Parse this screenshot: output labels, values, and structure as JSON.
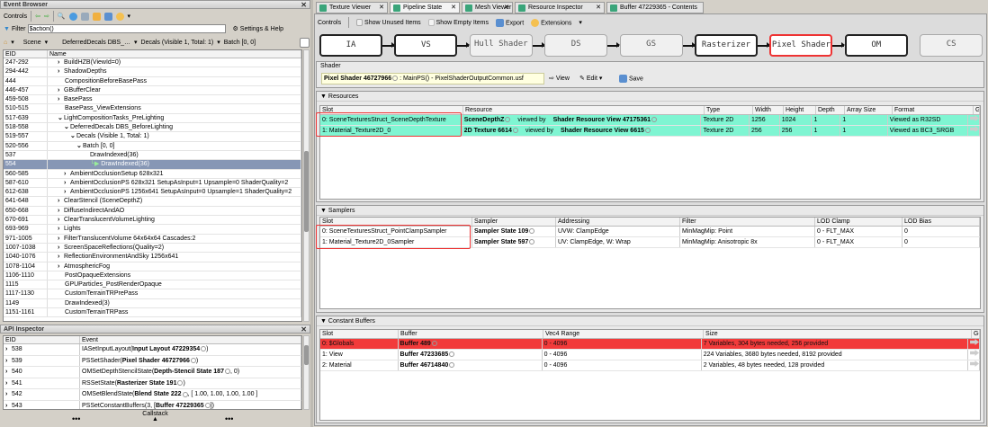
{
  "event_browser": {
    "title": "Event Browser",
    "controls_label": "Controls",
    "filter_label": "Filter",
    "filter_value": "$action()",
    "settings_label": "Settings & Help",
    "breadcrumb": [
      "Scene",
      "DeferredDecals DBS_…",
      "Decals (Visible 1, Total: 1)",
      "Batch [0, 0]"
    ],
    "columns": [
      "EID",
      "Name"
    ],
    "rows": [
      [
        "247-292",
        "BuildHZB(ViewId=0)",
        0,
        "closed"
      ],
      [
        "294-442",
        "ShadowDepths",
        0,
        "closed"
      ],
      [
        "444",
        "CompositionBeforeBasePass",
        0,
        "none"
      ],
      [
        "446-457",
        "GBufferClear",
        0,
        "closed"
      ],
      [
        "459-508",
        "BasePass",
        0,
        "closed"
      ],
      [
        "510-515",
        "BasePass_ViewExtensions",
        0,
        "none"
      ],
      [
        "517-639",
        "LightCompositionTasks_PreLighting",
        0,
        "open"
      ],
      [
        "518-558",
        "DeferredDecals DBS_BeforeLighting",
        1,
        "open"
      ],
      [
        "519-557",
        "Decals (Visible 1, Total: 1)",
        2,
        "open"
      ],
      [
        "520-556",
        "Batch [0, 0]",
        3,
        "open"
      ],
      [
        "537",
        "DrawIndexed(36)",
        4,
        "none"
      ],
      [
        "554",
        "DrawIndexed(36)",
        4,
        "current"
      ],
      [
        "560-585",
        "AmbientOcclusionSetup 628x321",
        1,
        "closed"
      ],
      [
        "587-610",
        "AmbientOcclusionPS 628x321 SetupAsInput=1 Upsample=0 ShaderQuality=2",
        1,
        "closed"
      ],
      [
        "612-638",
        "AmbientOcclusionPS 1256x641 SetupAsInput=0 Upsample=1 ShaderQuality=2",
        1,
        "closed"
      ],
      [
        "641-648",
        "ClearStencil (SceneDepthZ)",
        0,
        "closed"
      ],
      [
        "650-668",
        "DiffuseIndirectAndAO",
        0,
        "closed"
      ],
      [
        "670-691",
        "ClearTranslucentVolumeLighting",
        0,
        "closed"
      ],
      [
        "693-969",
        "Lights",
        0,
        "closed"
      ],
      [
        "971-1005",
        "FilterTranslucentVolume 64x64x64 Cascades:2",
        0,
        "closed"
      ],
      [
        "1007-1038",
        "ScreenSpaceReflections(Quality=2)",
        0,
        "closed"
      ],
      [
        "1040-1076",
        "ReflectionEnvironmentAndSky 1256x641",
        0,
        "closed"
      ],
      [
        "1078-1104",
        "AtmosphericFog",
        0,
        "closed"
      ],
      [
        "1106-1110",
        "PostOpaqueExtensions",
        0,
        "none"
      ],
      [
        "1115",
        "GPUParticles_PostRenderOpaque",
        0,
        "none"
      ],
      [
        "1117-1130",
        "CustomTerrainTRPrePass",
        0,
        "none"
      ],
      [
        "1149",
        "DrawIndexed(3)",
        0,
        "none"
      ],
      [
        "1151-1161",
        "CustomTerrainTRPass",
        0,
        "none"
      ]
    ],
    "selected_eid": "554"
  },
  "api_inspector": {
    "title": "API Inspector",
    "columns": [
      "EID",
      "Event"
    ],
    "rows": [
      [
        "538",
        "IASetInputLayout(",
        "Input Layout 47229354",
        ")"
      ],
      [
        "539",
        "PSSetShader(",
        "Pixel Shader 46727966",
        ")"
      ],
      [
        "540",
        "OMSetDepthStencilState(",
        "Depth-Stencil State 187",
        ", 0)"
      ],
      [
        "541",
        "RSSetState(",
        "Rasterizer State 191",
        ")"
      ],
      [
        "542",
        "OMSetBlendState(",
        "Blend State 222",
        ", [ 1.00, 1.00, 1.00, 1.00 ]"
      ],
      [
        "543",
        "PSSetConstantBuffers(3, [",
        "Buffer 47229365",
        "])"
      ]
    ],
    "callstack_label": "Callstack"
  },
  "tabs": [
    {
      "label": "Texture Viewer"
    },
    {
      "label": "Pipeline State",
      "active": true
    },
    {
      "label": "Mesh Viewer"
    },
    {
      "label": "Resource Inspector"
    },
    {
      "label": "Buffer 47229365 - Contents"
    }
  ],
  "pipeline": {
    "controls_label": "Controls",
    "show_unused": "Show Unused Items",
    "show_empty": "Show Empty Items",
    "export": "Export",
    "extensions": "Extensions",
    "stages": [
      {
        "label": "IA",
        "state": "on"
      },
      {
        "label": "VS",
        "state": "on"
      },
      {
        "label": "Hull Shader",
        "state": "off"
      },
      {
        "label": "DS",
        "state": "off"
      },
      {
        "label": "GS",
        "state": "off"
      },
      {
        "label": "Rasterizer",
        "state": "on"
      },
      {
        "label": "Pixel Shader",
        "state": "current"
      },
      {
        "label": "OM",
        "state": "on"
      },
      {
        "label": "CS",
        "state": "off"
      }
    ],
    "shader": {
      "group_title": "Shader",
      "name": "Pixel Shader 46727966",
      "entry": ": MainPS() - PixelShaderOutputCommon.usf",
      "view": "View",
      "edit": "Edit",
      "save": "Save"
    },
    "resources": {
      "title": "Resources",
      "columns": [
        "Slot",
        "Resource",
        "Type",
        "Width",
        "Height",
        "Depth",
        "Array Size",
        "Format",
        "Go"
      ],
      "rows": [
        [
          "0: SceneTexturesStruct_SceneDepthTexture",
          "SceneDepthZ",
          "Shader Resource View 47175361",
          "Texture 2D",
          "1256",
          "1024",
          "1",
          "1",
          "Viewed as R32SD"
        ],
        [
          "1: Material_Texture2D_0",
          "2D Texture 6614",
          "Shader Resource View 6615",
          "Texture 2D",
          "256",
          "256",
          "1",
          "1",
          "Viewed as BC3_SRGB"
        ]
      ],
      "viewed_by": "viewed by"
    },
    "samplers": {
      "title": "Samplers",
      "columns": [
        "Slot",
        "Sampler",
        "Addressing",
        "Filter",
        "LOD Clamp",
        "LOD Bias"
      ],
      "rows": [
        [
          "0: SceneTexturesStruct_PointClampSampler",
          "Sampler State 109",
          "UVW: ClampEdge",
          "MinMagMip: Point",
          "0 - FLT_MAX",
          "0"
        ],
        [
          "1: Material_Texture2D_0Sampler",
          "Sampler State 597",
          "UV: ClampEdge, W: Wrap",
          "MinMagMip: Anisotropic 8x",
          "0 - FLT_MAX",
          "0"
        ]
      ]
    },
    "constant_buffers": {
      "title": "Constant Buffers",
      "columns": [
        "Slot",
        "Buffer",
        "Vec4 Range",
        "Size",
        "Go"
      ],
      "rows": [
        [
          "0: $Globals",
          "Buffer 489",
          "0 - 4096",
          "7 Variables, 304 bytes needed, 256 provided"
        ],
        [
          "1: View",
          "Buffer 47233685",
          "0 - 4096",
          "224 Variables, 3680 bytes needed, 8192 provided"
        ],
        [
          "2: Material",
          "Buffer 46714840",
          "0 - 4096",
          "2 Variables, 48 bytes needed, 128 provided"
        ]
      ],
      "error_row": 0
    }
  },
  "colors": {
    "selected_row": "#8797b5",
    "resource_highlight": "#7ff5d2",
    "error_row": "#f23a3a",
    "current_stage_border": "#ee3333"
  }
}
